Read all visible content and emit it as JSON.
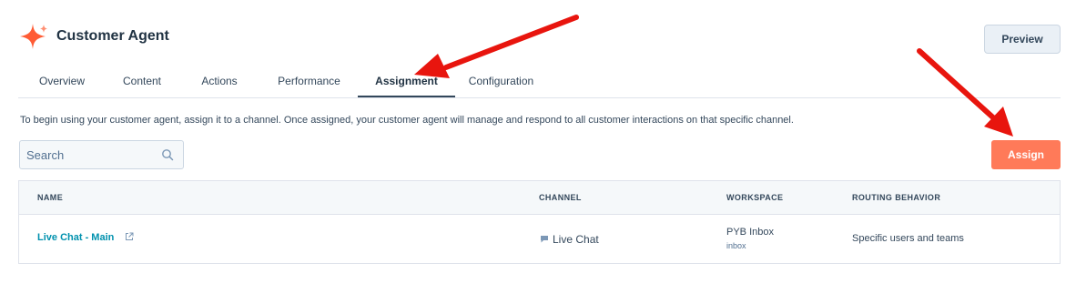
{
  "header": {
    "title": "Customer Agent",
    "preview_label": "Preview"
  },
  "tabs": [
    {
      "label": "Overview",
      "active": false
    },
    {
      "label": "Content",
      "active": false
    },
    {
      "label": "Actions",
      "active": false
    },
    {
      "label": "Performance",
      "active": false
    },
    {
      "label": "Assignment",
      "active": true
    },
    {
      "label": "Configuration",
      "active": false
    }
  ],
  "intro": "To begin using your customer agent, assign it to a channel. Once assigned, your customer agent will manage and respond to all customer interactions on that specific channel.",
  "search": {
    "placeholder": "Search"
  },
  "assign_label": "Assign",
  "table": {
    "columns": [
      "NAME",
      "CHANNEL",
      "WORKSPACE",
      "ROUTING BEHAVIOR"
    ],
    "rows": [
      {
        "name": "Live Chat - Main",
        "channel": "Live Chat",
        "workspace": "PYB Inbox",
        "workspace_sub": "inbox",
        "routing": "Specific users and teams"
      }
    ]
  },
  "colors": {
    "accent": "#ff7a59",
    "link": "#0091ae",
    "annotation_arrow": "#e8150e",
    "text": "#33475b"
  },
  "icons": [
    "sparkle-logo-icon",
    "search-icon",
    "external-link-icon",
    "chat-bubble-icon"
  ]
}
